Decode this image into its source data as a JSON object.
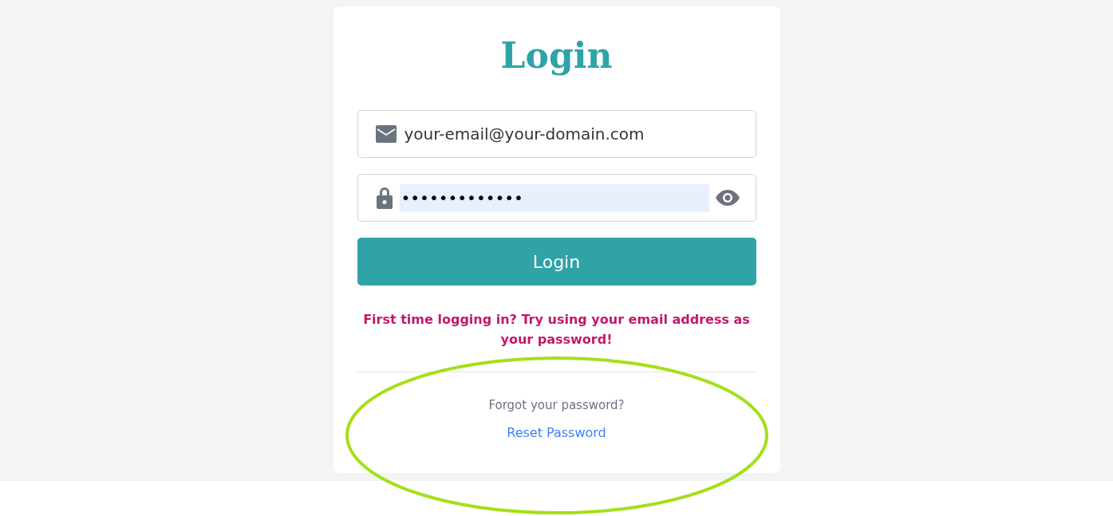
{
  "title": "Login",
  "email_field": {
    "value": "your-email@your-domain.com"
  },
  "password_field": {
    "value": "•••••••••••••",
    "autofilled": true
  },
  "login_button": "Login",
  "hint": "First time logging in? Try using your email address as your password!",
  "forgot_text": "Forgot your password?",
  "reset_link": "Reset Password",
  "annotation": {
    "kind": "ellipse"
  }
}
